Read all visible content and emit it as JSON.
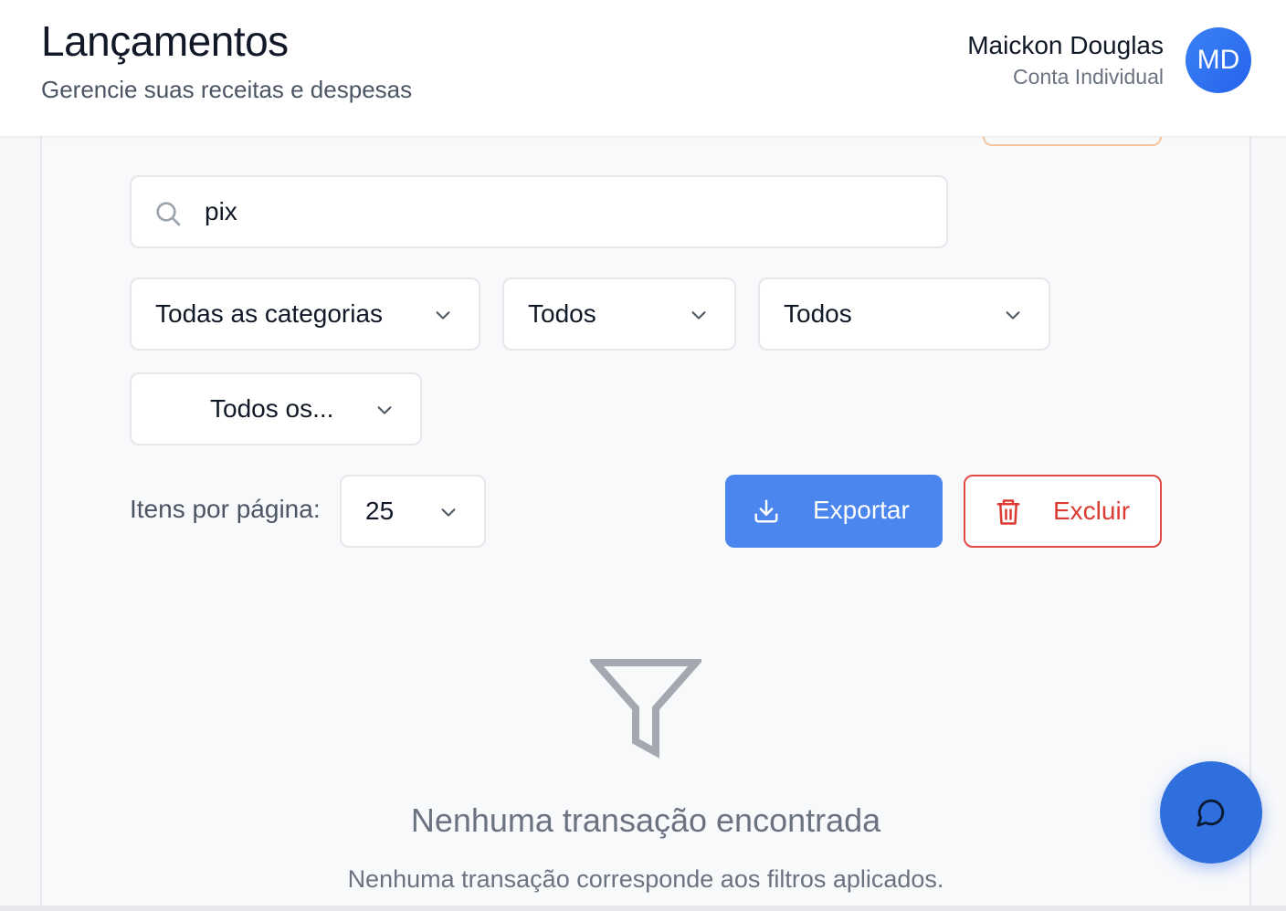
{
  "header": {
    "title": "Lançamentos",
    "subtitle": "Gerencie suas receitas e despesas"
  },
  "user": {
    "name": "Maickon Douglas",
    "account_type": "Conta Individual",
    "initials": "MD"
  },
  "filters": {
    "search": {
      "value": "pix",
      "icon": "search-icon"
    },
    "category": {
      "selected": "Todas as categorias"
    },
    "type": {
      "selected": "Todos"
    },
    "status": {
      "selected": "Todos"
    },
    "period": {
      "selected": "Todos os..."
    }
  },
  "pagination": {
    "label": "Itens por página:",
    "per_page": "25"
  },
  "actions": {
    "export_label": "Exportar",
    "export_icon": "download-icon",
    "delete_label": "Excluir",
    "delete_icon": "trash-icon"
  },
  "empty_state": {
    "icon": "filter-icon",
    "title": "Nenhuma transação encontrada",
    "description": "Nenhuma transação corresponde aos filtros aplicados."
  },
  "chat": {
    "icon": "chat-bubble-icon"
  },
  "colors": {
    "primary": "#4a86ee",
    "avatar": "#2563eb",
    "danger": "#dc3b33",
    "muted_text": "#6b7280",
    "border": "#e5e7eb"
  }
}
